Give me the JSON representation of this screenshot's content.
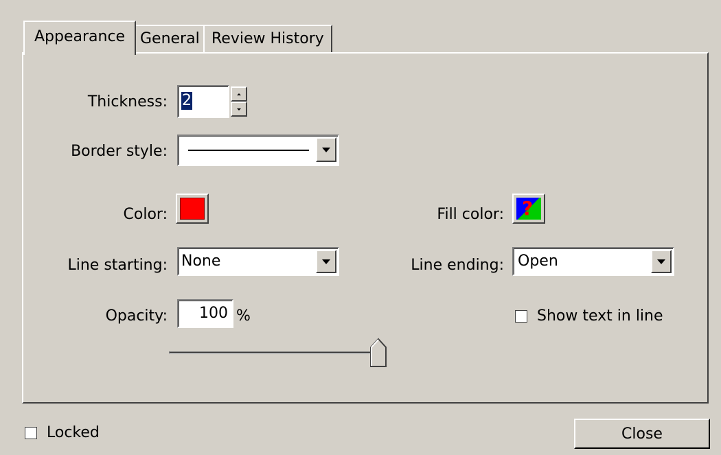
{
  "tabs": [
    {
      "label": "Appearance",
      "active": true
    },
    {
      "label": "General",
      "active": false
    },
    {
      "label": "Review History",
      "active": false
    }
  ],
  "thickness": {
    "label": "Thickness:",
    "value": "2"
  },
  "border_style": {
    "label": "Border style:",
    "value": "solid-line"
  },
  "color": {
    "label": "Color:",
    "value": "#ff0000"
  },
  "fill_color": {
    "label": "Fill color:",
    "value": "?"
  },
  "line_starting": {
    "label": "Line starting:",
    "value": "None"
  },
  "line_ending": {
    "label": "Line ending:",
    "value": "Open"
  },
  "opacity": {
    "label": "Opacity:",
    "value": "100",
    "unit": "%",
    "slider_fraction": 1.0
  },
  "show_text_in_line": {
    "label": "Show text in line",
    "checked": false
  },
  "locked": {
    "label": "Locked",
    "checked": false
  },
  "close_button": {
    "label": "Close"
  }
}
